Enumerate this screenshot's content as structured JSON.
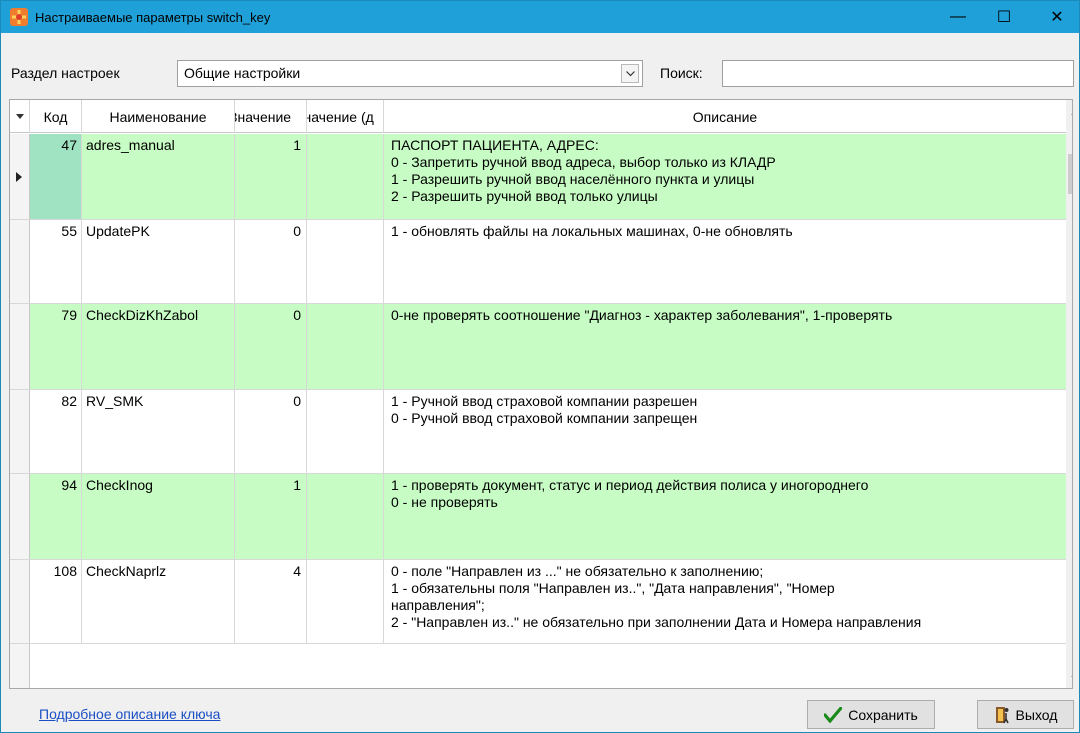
{
  "window": {
    "title": "Настраиваемые параметры switch_key",
    "accent": "#1fa0d8",
    "controls": {
      "minimize": "—",
      "maximize": "☐",
      "close": "✕"
    }
  },
  "toolbar": {
    "section_label": "Раздел настроек",
    "section_value": "Общие настройки",
    "search_label": "Поиск:",
    "search_value": ""
  },
  "table": {
    "headers": [
      "Код",
      "Наименование",
      "Значение",
      "Значение (д",
      "Описание"
    ],
    "rows": [
      {
        "code": "47",
        "name": "adres_manual",
        "value": "1",
        "value_default": "",
        "description": "ПАСПОРТ ПАЦИЕНТА, АДРЕС:\n0 - Запретить ручной ввод адреса, выбор только из КЛАДР\n1 - Разрешить ручной ввод населённого пункта и улицы\n2 - Разрешить ручной ввод только улицы",
        "highlight": true,
        "selected": true
      },
      {
        "code": "55",
        "name": "UpdatePK",
        "value": "0",
        "value_default": "",
        "description": "1 - обновлять файлы на локальных машинах, 0-не обновлять",
        "highlight": false
      },
      {
        "code": "79",
        "name": "CheckDizKhZabol",
        "value": "0",
        "value_default": "",
        "description": "0-не проверять соотношение \"Диагноз - характер заболевания\", 1-проверять",
        "highlight": true
      },
      {
        "code": "82",
        "name": "RV_SMK",
        "value": "0",
        "value_default": "",
        "description": "1 - Ручной ввод страховой компании разрешен\n0 - Ручной ввод страховой компании запрещен",
        "highlight": false
      },
      {
        "code": "94",
        "name": "CheckInog",
        "value": "1",
        "value_default": "",
        "description": "1 - проверять документ, статус и период действия полиса у иногороднего\n0 - не проверять",
        "highlight": true
      },
      {
        "code": "108",
        "name": "CheckNaprlz",
        "value": "4",
        "value_default": "",
        "description": "0 - поле \"Направлен из ...\" не обязательно к заполнению;\n1 - обязательны поля \"Направлен из..\", \"Дата направления\", \"Номер\nнаправления\";\n2 - \"Направлен из..\" не обязательно при заполнении Дата и Номера направления",
        "highlight": false
      }
    ],
    "highlight_color": "#c7fcc4"
  },
  "footer": {
    "link_text": "Подробное описание ключа",
    "save_label": "Сохранить",
    "exit_label": "Выход"
  }
}
